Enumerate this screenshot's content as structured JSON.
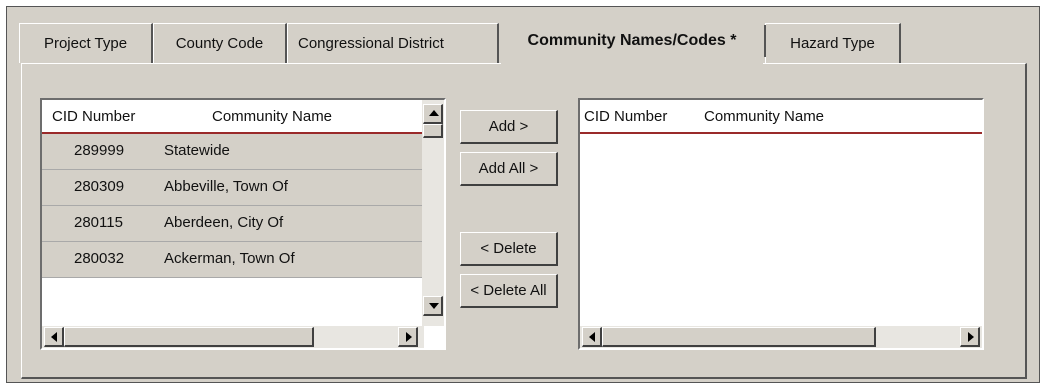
{
  "tabs": [
    {
      "label": "Project Type"
    },
    {
      "label": "County Code"
    },
    {
      "label": "Congressional District"
    },
    {
      "label": "Community Names/Codes *"
    },
    {
      "label": "Hazard Type"
    }
  ],
  "available": {
    "headers": {
      "cid": "CID Number",
      "name": "Community Name"
    },
    "rows": [
      {
        "cid": "289999",
        "name": "Statewide"
      },
      {
        "cid": "280309",
        "name": "Abbeville, Town Of"
      },
      {
        "cid": "280115",
        "name": "Aberdeen, City Of"
      },
      {
        "cid": "280032",
        "name": "Ackerman, Town Of"
      }
    ]
  },
  "selected": {
    "headers": {
      "cid": "CID Number",
      "name": "Community Name"
    },
    "rows": []
  },
  "buttons": {
    "add": "Add >",
    "add_all": "Add All >",
    "delete": "< Delete",
    "delete_all": "< Delete All"
  },
  "colors": {
    "background": "#d4d0c8",
    "header_rule": "#9a2a2a"
  }
}
